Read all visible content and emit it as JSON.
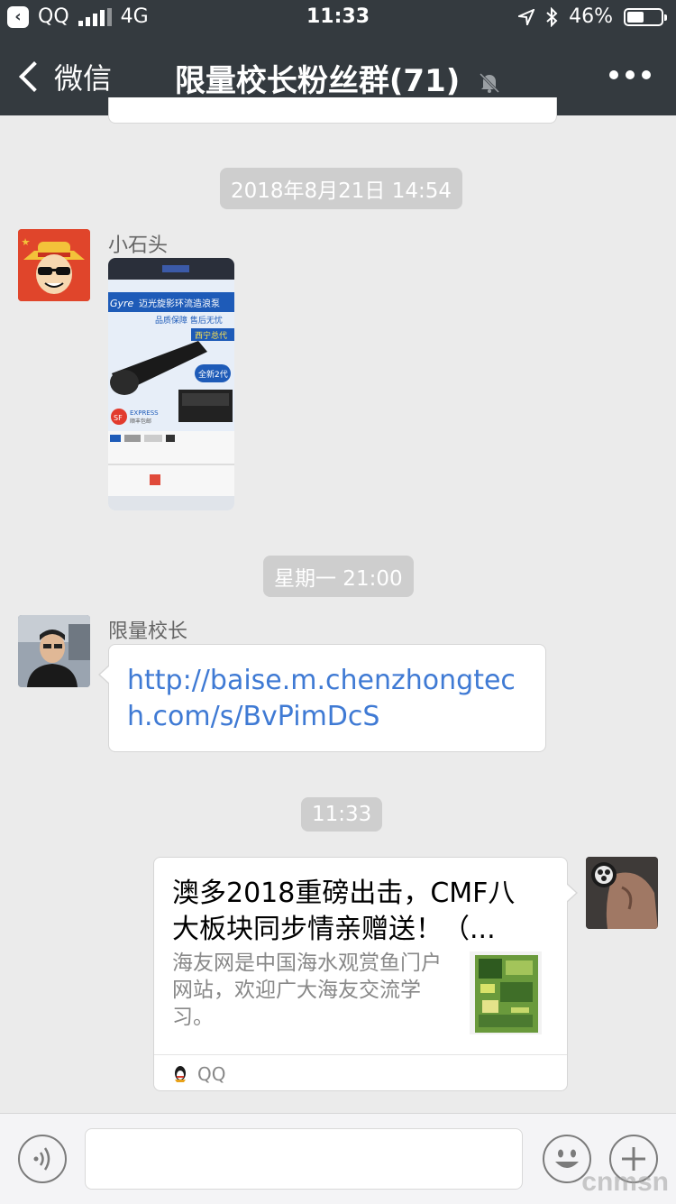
{
  "status_bar": {
    "back_app": "QQ",
    "network": "4G",
    "time": "11:33",
    "battery": "46%"
  },
  "nav": {
    "back_label": "微信",
    "title": "限量校长粉丝群(71)"
  },
  "messages": [
    {
      "type": "time",
      "text": "2018年8月21日 14:54"
    },
    {
      "type": "image",
      "sender": "小石头",
      "image_text": {
        "brand": "Gyre",
        "headline": "迈光旋影环流造浪泵",
        "sub1": "品质保障 售后无忧",
        "sub2": "西宁总代",
        "badge": "全新2代",
        "sf": "SF",
        "sf_label": "EXPRESS",
        "sf_sub": "顺丰包邮"
      }
    },
    {
      "type": "time",
      "text": "星期一 21:00"
    },
    {
      "type": "link",
      "sender": "限量校长",
      "text": "http://baise.m.chenzhongtech.com/s/BvPimDcS"
    },
    {
      "type": "time",
      "text": "11:33"
    },
    {
      "type": "share_card",
      "title": "澳多2018重磅出击，CMF八大板块同步情亲赠送！（...",
      "description": "海友网是中国海水观赏鱼门户网站，欢迎广大海友交流学习。",
      "source": "QQ"
    }
  ],
  "watermark": "cnmsn",
  "icons": [
    "qq-back-icon",
    "signal-icon",
    "location-arrow-icon",
    "bluetooth-icon",
    "battery-icon",
    "mute-bell-icon",
    "more-icon",
    "voice-icon",
    "emoji-icon",
    "plus-icon",
    "qq-penguin-icon"
  ],
  "colors": {
    "header": "#343a3f",
    "background": "#ebebeb",
    "link": "#3f7ad4",
    "time_pill": "#cecece"
  }
}
